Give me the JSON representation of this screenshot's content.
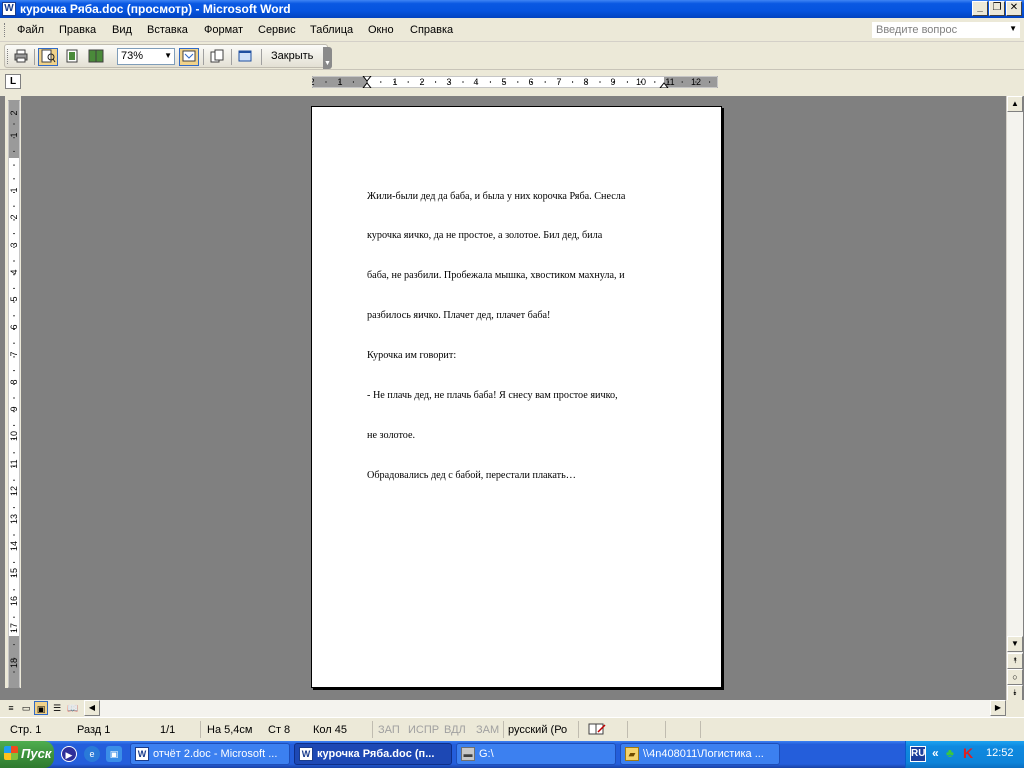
{
  "window": {
    "title": "курочка Ряба.doc (просмотр) - Microsoft Word",
    "doc_icon_letter": "W"
  },
  "menu": {
    "items": [
      "Файл",
      "Правка",
      "Вид",
      "Вставка",
      "Формат",
      "Сервис",
      "Таблица",
      "Окно",
      "Справка"
    ],
    "help_placeholder": "Введите вопрос"
  },
  "toolbar": {
    "zoom": "73%",
    "close_label": "Закрыть"
  },
  "ruler": {
    "h_labels": [
      "2",
      "1",
      "1",
      "2",
      "3",
      "4",
      "5",
      "6",
      "7",
      "8",
      "9",
      "10",
      "11",
      "12"
    ],
    "v_labels": [
      "2",
      "1",
      "1",
      "2",
      "3",
      "4",
      "5",
      "6",
      "7",
      "8",
      "9",
      "10",
      "11",
      "12",
      "13",
      "14",
      "15",
      "16",
      "17",
      "18"
    ],
    "corner": "L"
  },
  "document": {
    "lines": [
      "Жили-были дед да баба, и была у них корочка Ряба. Снесла",
      "курочка яичко, да не простое, а золотое. Бил дед, била",
      "баба, не разбили. Пробежала мышка, хвостиком махнула, и",
      "разбилось яичко. Плачет дед, плачет баба!",
      "Курочка им говорит:",
      "- Не плачь дед, не плачь баба! Я снесу вам простое яичко,",
      "не золотое.",
      "Обрадовались дед с бабой, перестали плакать…"
    ]
  },
  "status": {
    "page": "Стр. 1",
    "section": "Разд 1",
    "pages": "1/1",
    "at": "На 5,4см",
    "line": "Ст 8",
    "col": "Кол 45",
    "rec": "ЗАП",
    "trk": "ИСПР",
    "ext": "ВДЛ",
    "ovr": "ЗАМ",
    "lang": "русский (Ро"
  },
  "taskbar": {
    "start": "Пуск",
    "tasks": [
      {
        "label": "отчёт 2.doc - Microsoft ..."
      },
      {
        "label": "курочка Ряба.doc (п..."
      },
      {
        "label": "G:\\"
      },
      {
        "label": "\\\\4n408011\\Логистика ..."
      }
    ],
    "lang": "RU",
    "clock": "12:52"
  },
  "colors": {
    "title_bar": "#0a58e2",
    "chrome": "#ece9d8",
    "workspace": "#808080",
    "taskbar": "#245edb",
    "start": "#3a8d3a"
  }
}
